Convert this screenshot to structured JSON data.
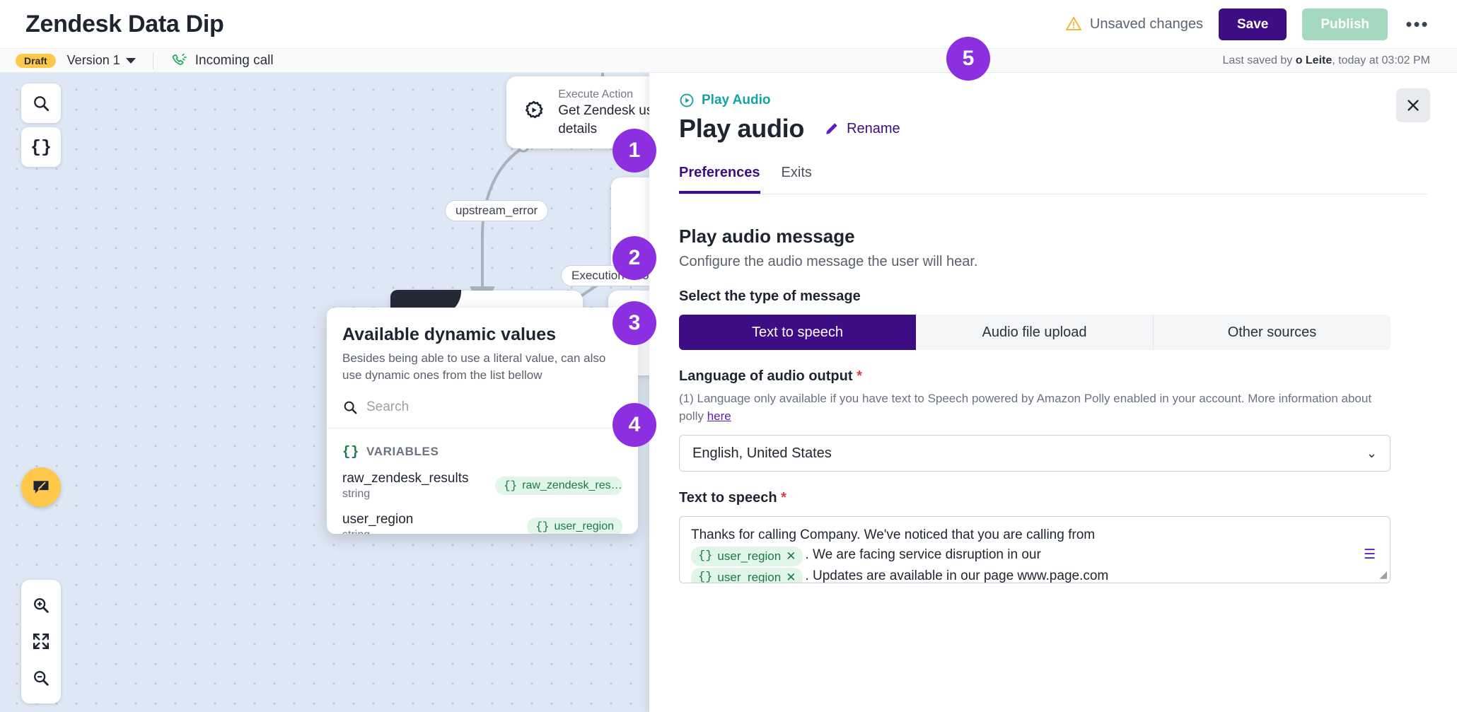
{
  "header": {
    "app_title": "Zendesk Data Dip",
    "unsaved_label": "Unsaved changes",
    "save_label": "Save",
    "publish_label": "Publish",
    "more_label": "•••"
  },
  "subheader": {
    "draft_badge": "Draft",
    "version_label": "Version 1",
    "trigger_label": "Incoming call",
    "last_saved": "Last saved by ",
    "last_saved_user": "o Leite",
    "last_saved_time": ", today at 03:02 PM"
  },
  "canvas": {
    "tools": {
      "search_icon": "search-icon",
      "variables_icon": "braces-icon",
      "note_icon": "note-edit-icon",
      "zoom_in_icon": "zoom-in-icon",
      "fit_icon": "fit-screen-icon",
      "zoom_out_icon": "zoom-out-icon"
    },
    "nodes": [
      {
        "kicker": "Execute Action",
        "title": "Get Zendesk user details",
        "icon": "gear-play-icon"
      },
      {
        "kicker": "",
        "title": "",
        "icon": "fx-icon"
      }
    ],
    "edge_labels": [
      "upstream_error",
      "Execution error"
    ]
  },
  "panel": {
    "kicker": "Play Audio",
    "title": "Play audio",
    "rename_label": "Rename",
    "close_icon": "close-icon",
    "tabs": [
      {
        "label": "Preferences",
        "active": true
      },
      {
        "label": "Exits",
        "active": false
      }
    ],
    "section_title": "Play audio message",
    "section_sub": "Configure the audio message the user will hear.",
    "type_label": "Select the type of message",
    "type_options": [
      {
        "label": "Text to speech",
        "active": true
      },
      {
        "label": "Audio file upload",
        "active": false
      },
      {
        "label": "Other sources",
        "active": false
      }
    ],
    "language_label": "Language of audio output",
    "language_hint_1": "(1) Language only available if you have text to Speech powered by Amazon Polly enabled in your",
    "language_hint_2": "account. More information about polly ",
    "language_hint_link": "here",
    "language_value": "English, United States",
    "tts_label": "Text to speech",
    "tts": {
      "line1": "Thanks for calling Company. We've noticed that you are calling from",
      "token1": "user_region",
      "line2": ". We are facing service disruption in our",
      "token2": "user_region",
      "line3": ". Updates are available in our page www.page.com"
    }
  },
  "dynamic_values": {
    "title": "Available dynamic values",
    "subtitle": "Besides being able to use a literal value, can also use dynamic ones from the list bellow",
    "search_placeholder": "Search",
    "group_label": "VARIABLES",
    "items": [
      {
        "name": "raw_zendesk_results",
        "type": "string",
        "pill": "raw_zendesk_res…"
      },
      {
        "name": "user_region",
        "type": "string",
        "pill": "user_region"
      }
    ]
  },
  "steps": [
    "1",
    "2",
    "3",
    "4",
    "5"
  ],
  "colors": {
    "primary": "#3c0d83",
    "step": "#8b2fe0",
    "teal": "#14a3a3",
    "green_chip": "#e2f5e9",
    "draft_yellow": "#ffc84b"
  }
}
